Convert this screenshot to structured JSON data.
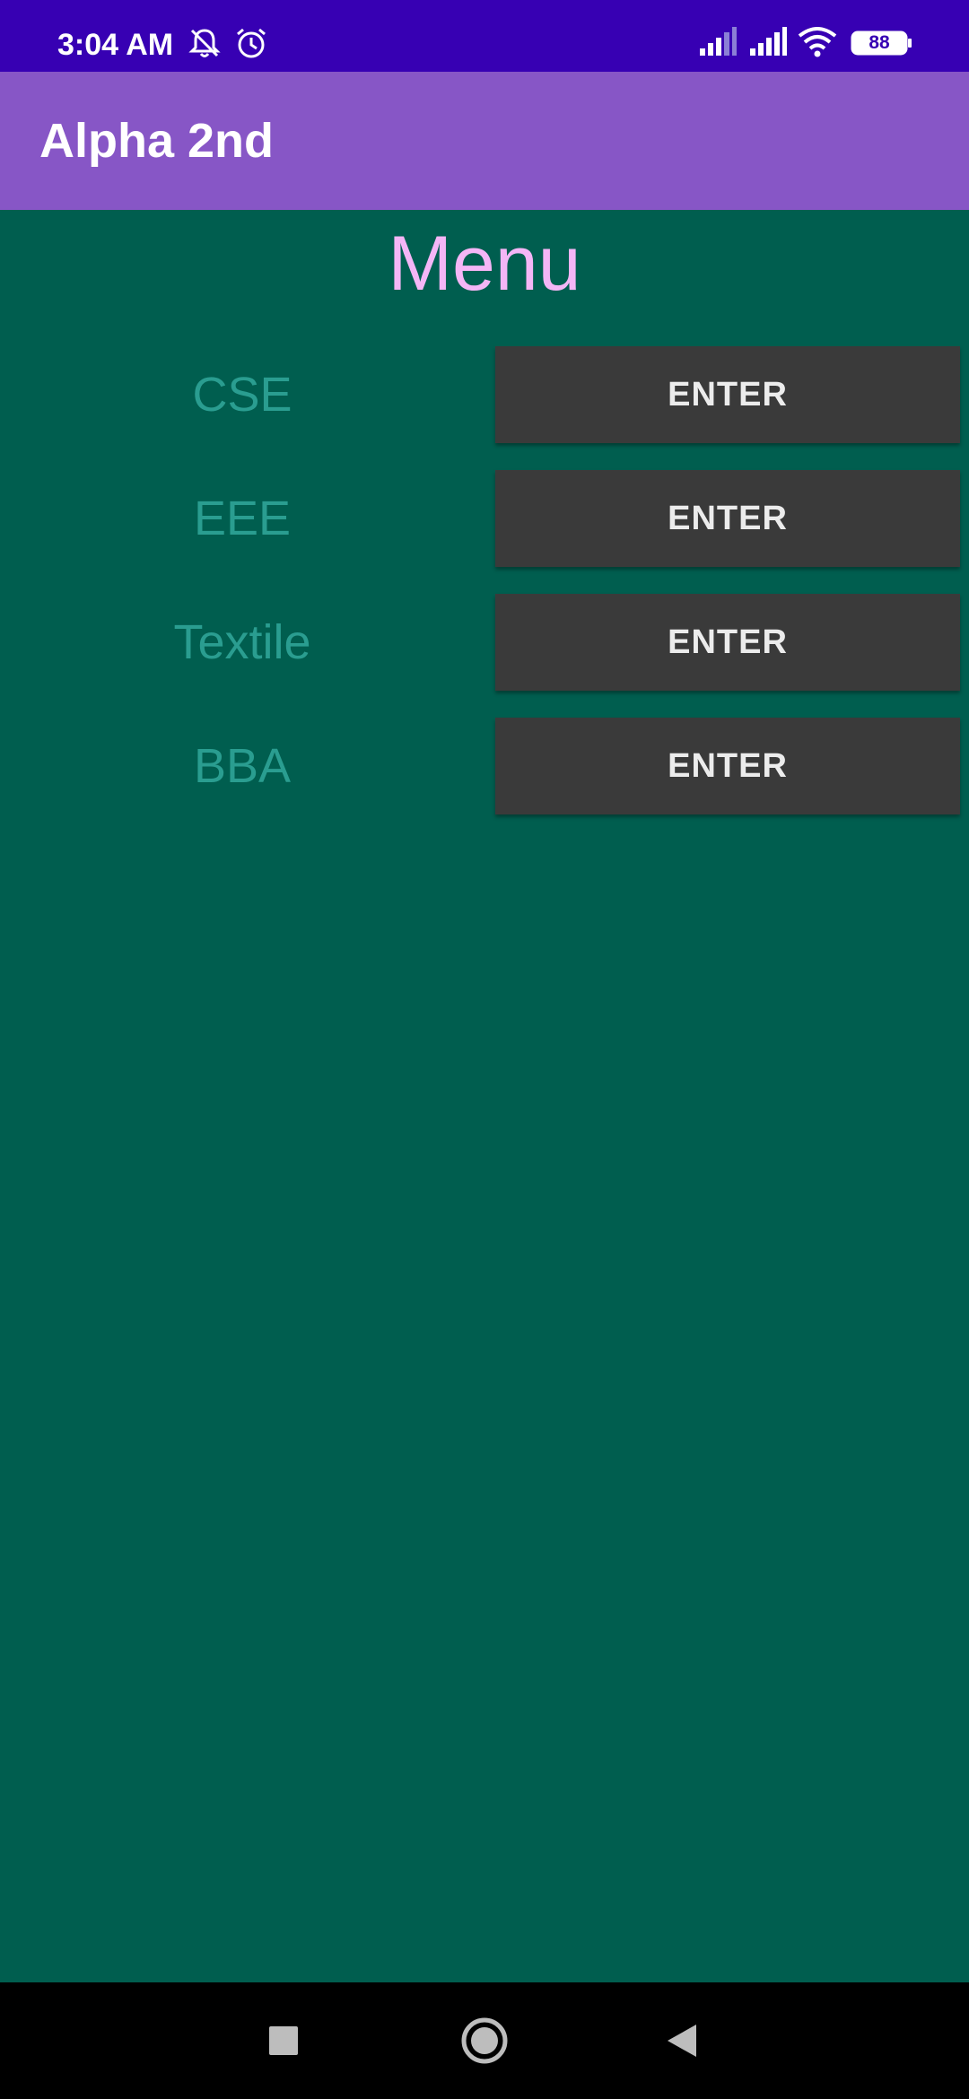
{
  "status_bar": {
    "time": "3:04 AM",
    "battery": "88",
    "icons": [
      "mute-icon",
      "alarm-icon",
      "signal-1-icon",
      "signal-2-icon",
      "wifi-icon",
      "battery-icon"
    ]
  },
  "app_bar": {
    "title": "Alpha 2nd",
    "background": "#8756c6"
  },
  "content": {
    "title": "Menu",
    "background": "#005e4f",
    "rows": [
      {
        "label": "CSE",
        "button": "ENTER"
      },
      {
        "label": "EEE",
        "button": "ENTER"
      },
      {
        "label": "Textile",
        "button": "ENTER"
      },
      {
        "label": "BBA",
        "button": "ENTER"
      }
    ]
  },
  "nav_bar": {
    "icons": [
      "recents-icon",
      "home-icon",
      "back-icon"
    ]
  },
  "colors": {
    "status_bar": "#3700b3",
    "title_text": "#f4b6f6",
    "label_text": "#2a9d90",
    "button_bg": "#3a3a3a"
  }
}
